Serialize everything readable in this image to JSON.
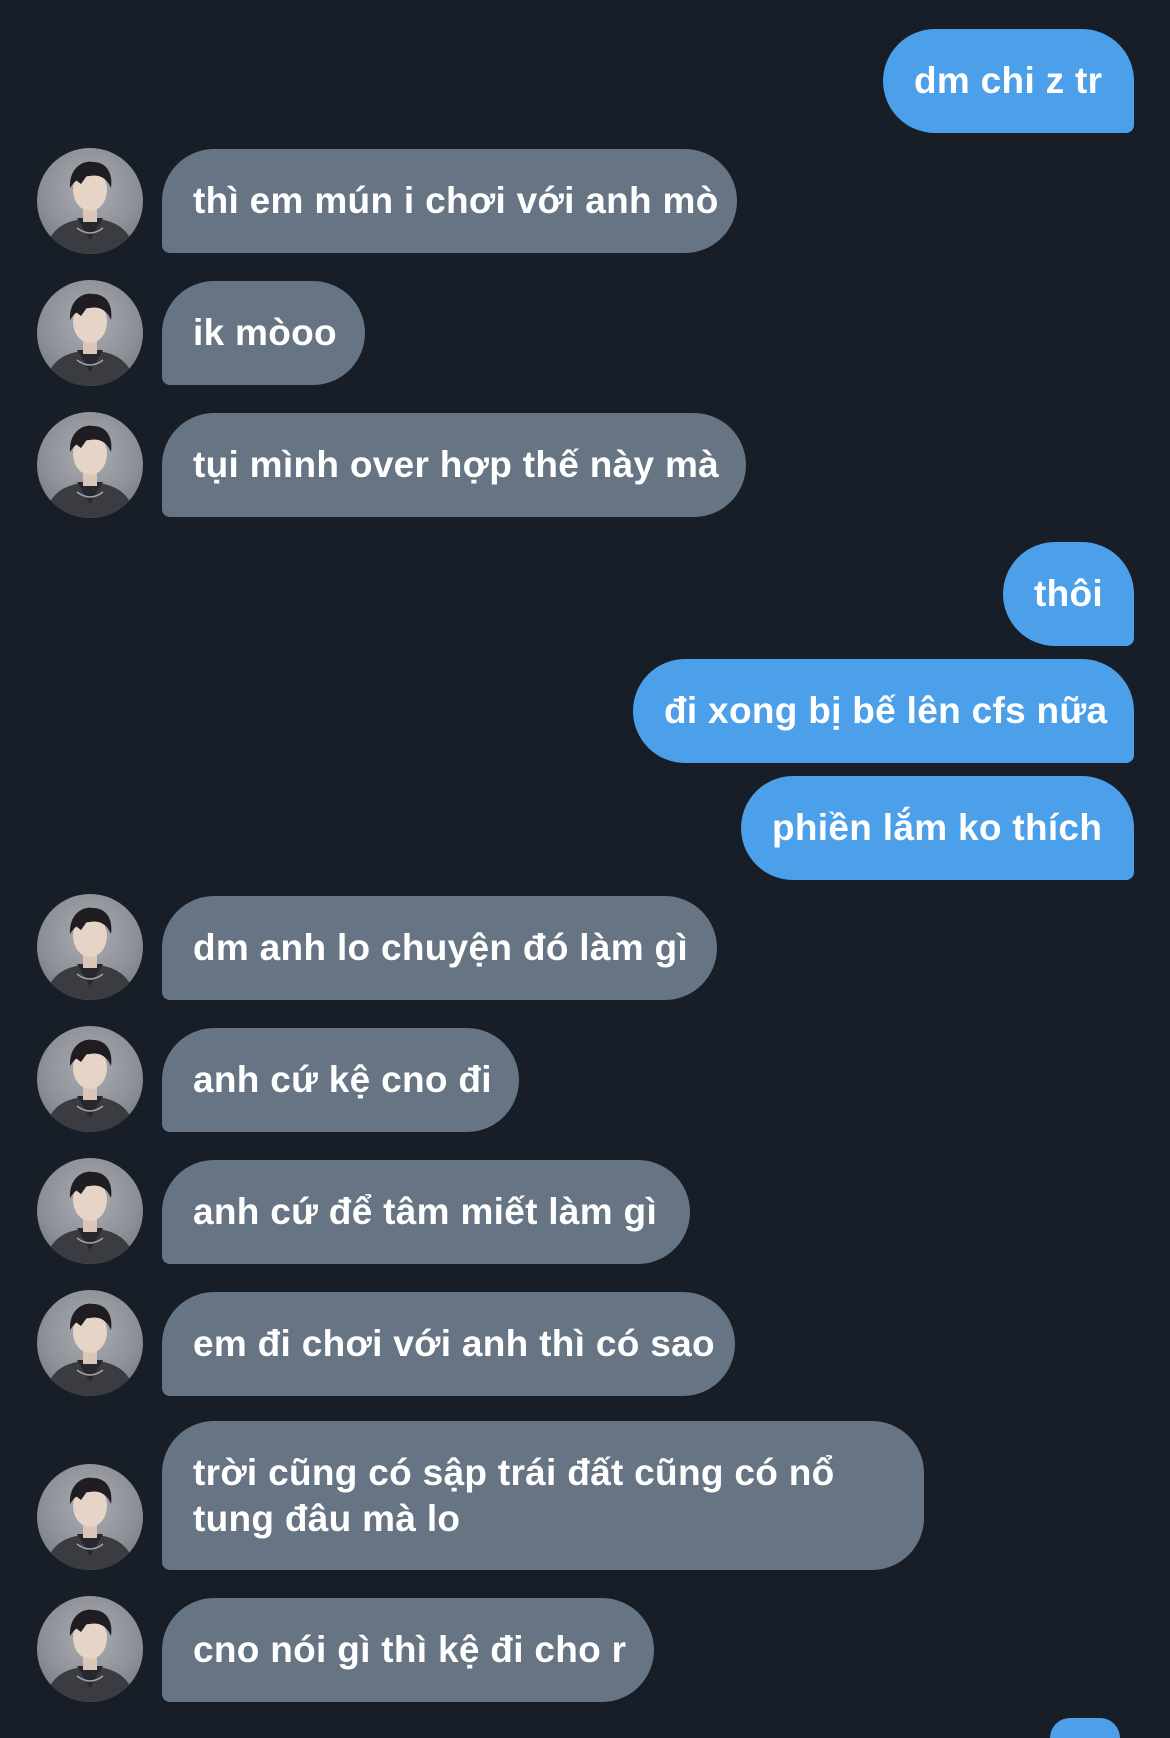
{
  "conversation": {
    "messages": [
      {
        "side": "sent",
        "text": "dm chi z tr"
      },
      {
        "side": "received",
        "text": "thì em mún i chơi với anh mò"
      },
      {
        "side": "received",
        "text": "ik mòoo"
      },
      {
        "side": "received",
        "text": "tụi mình over hợp thế này mà"
      },
      {
        "side": "sent",
        "text": "thôi"
      },
      {
        "side": "sent",
        "text": "đi xong bị bế lên cfs nữa"
      },
      {
        "side": "sent",
        "text": "phiền lắm ko thích"
      },
      {
        "side": "received",
        "text": "dm anh lo chuyện đó làm gì"
      },
      {
        "side": "received",
        "text": "anh cứ kệ cno đi"
      },
      {
        "side": "received",
        "text": "anh cứ để tâm miết làm gì"
      },
      {
        "side": "received",
        "text": "em đi chơi với anh thì có sao"
      },
      {
        "side": "received",
        "text": "trời cũng có sập trái đất cũng có nổ tung đâu mà lo"
      },
      {
        "side": "received",
        "text": "cno nói gì thì kệ đi cho r"
      }
    ]
  },
  "colors": {
    "background": "#171e27",
    "sent_bubble": "#4c9fe9",
    "received_bubble": "#667483",
    "text": "#ffffff"
  },
  "icons": {
    "avatar": "contact-avatar-photo"
  }
}
